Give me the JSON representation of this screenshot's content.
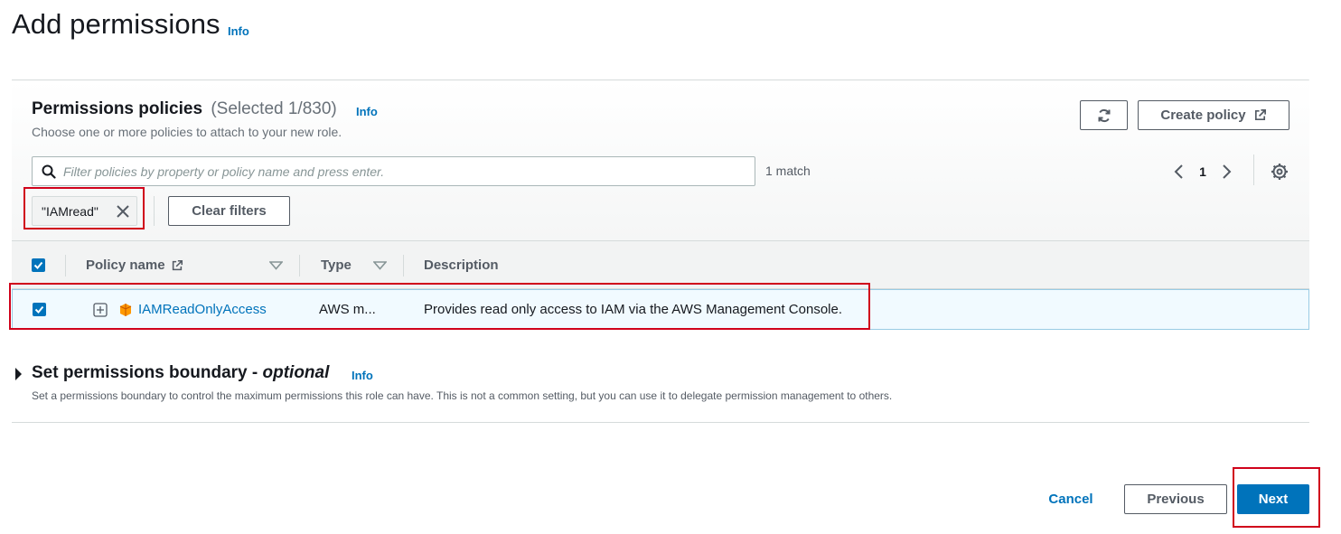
{
  "page": {
    "title": "Add permissions",
    "info_label": "Info"
  },
  "policies_panel": {
    "title": "Permissions policies",
    "selected_count": "(Selected 1/830)",
    "info_label": "Info",
    "description": "Choose one or more policies to attach to your new role.",
    "refresh_icon": "refresh-icon",
    "create_policy_label": "Create policy",
    "create_policy_icon": "external-link-icon",
    "search": {
      "placeholder": "Filter policies by property or policy name and press enter.",
      "value": ""
    },
    "match_text": "1 match",
    "pagination": {
      "current_page": "1"
    },
    "filter_token": "\"IAMread\"",
    "clear_filters_label": "Clear filters",
    "table": {
      "columns": [
        "Policy name",
        "Type",
        "Description"
      ],
      "rows": [
        {
          "selected": true,
          "policy_name": "IAMReadOnlyAccess",
          "type": "AWS m...",
          "description": "Provides read only access to IAM via the AWS Management Console."
        }
      ]
    }
  },
  "boundary": {
    "title": "Set permissions boundary - ",
    "title_optional": "optional",
    "info_label": "Info",
    "description": "Set a permissions boundary to control the maximum permissions this role can have. This is not a common setting, but you can use it to delegate permission management to others."
  },
  "footer": {
    "cancel_label": "Cancel",
    "previous_label": "Previous",
    "next_label": "Next"
  },
  "colors": {
    "accent": "#0073bb",
    "highlight_box": "#d0021b",
    "policy_icon": "#f90"
  }
}
